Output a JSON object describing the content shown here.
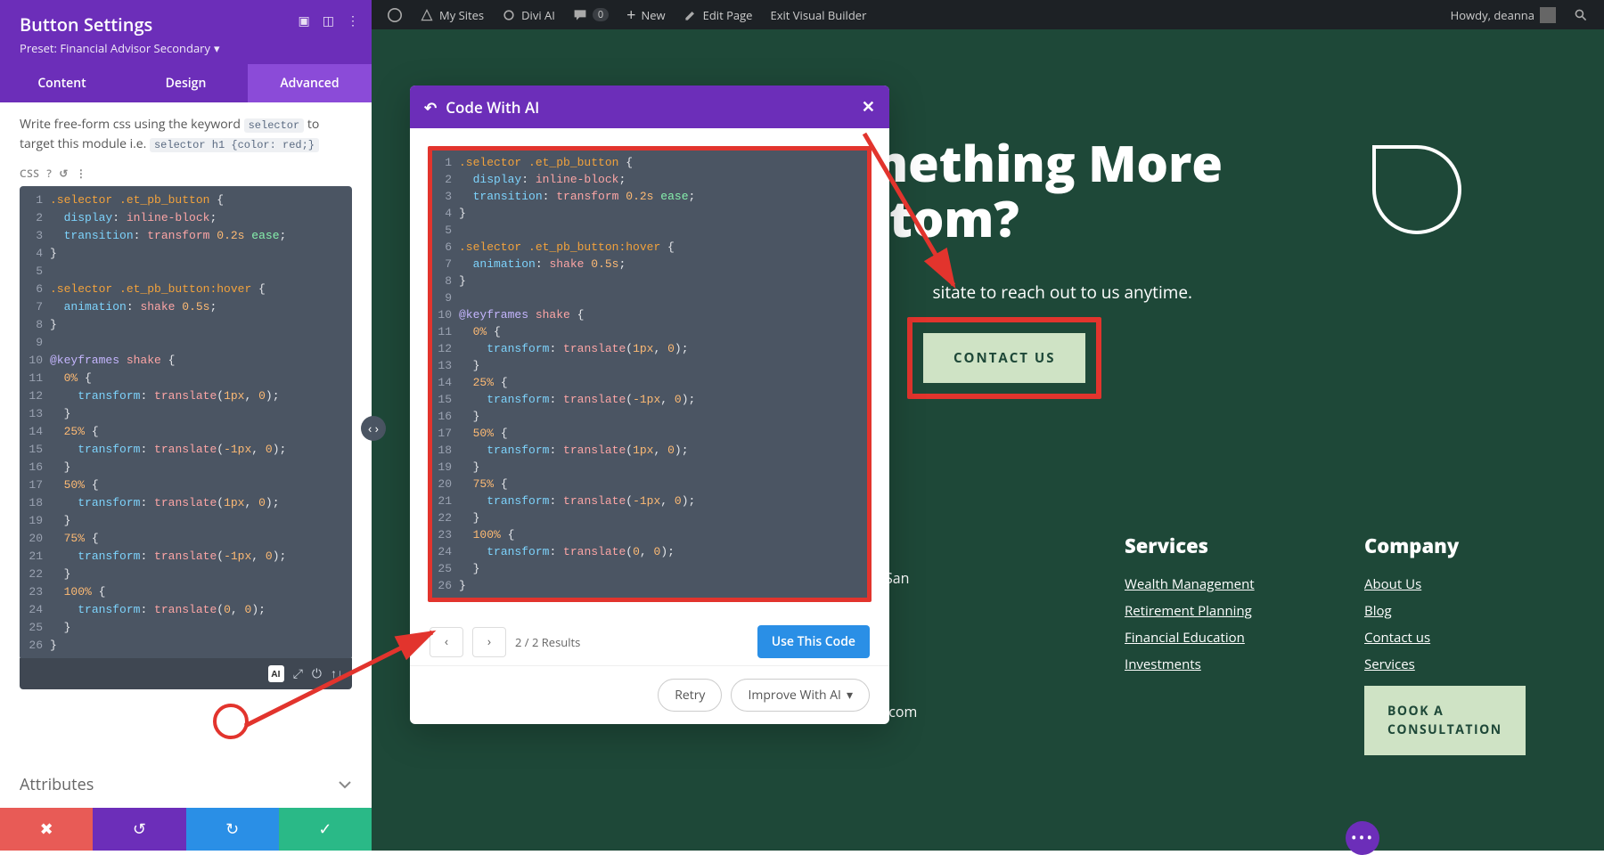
{
  "wp_bar": {
    "my_sites": "My Sites",
    "divi_ai": "Divi AI",
    "comments": "0",
    "new": "New",
    "edit_page": "Edit Page",
    "exit_builder": "Exit Visual Builder",
    "howdy": "Howdy, deanna"
  },
  "panel": {
    "title": "Button Settings",
    "preset": "Preset: Financial Advisor Secondary",
    "tabs": {
      "content": "Content",
      "design": "Design",
      "advanced": "Advanced"
    },
    "help_pre": "Write free-form css using the keyword ",
    "help_code1": "selector",
    "help_mid": " to target this module i.e. ",
    "help_code2": "selector h1 {color: red;}",
    "css_label": "CSS",
    "ai_badge": "AI",
    "attributes": "Attributes",
    "code": [
      {
        "n": "1",
        "s": ".selector .et_pb_button",
        "t": " {"
      },
      {
        "n": "2",
        "p": "display",
        "pv": ": ",
        "v": "inline-block",
        "pe": ";"
      },
      {
        "n": "3",
        "p": "transition",
        "pv": ": ",
        "vparts": [
          {
            "c": "tok-val",
            "t": "transform"
          },
          {
            "c": "",
            "t": " "
          },
          {
            "c": "tok-num",
            "t": "0.2s"
          },
          {
            "c": "",
            "t": " "
          },
          {
            "c": "tok-ease",
            "t": "ease"
          }
        ],
        "pe": ";"
      },
      {
        "n": "4",
        "t": "}"
      },
      {
        "n": "5",
        "t": ""
      },
      {
        "n": "6",
        "s": ".selector .et_pb_button",
        "shov": ":hover",
        "t": " {"
      },
      {
        "n": "7",
        "p": "animation",
        "pv": ": ",
        "vparts": [
          {
            "c": "tok-val",
            "t": "shake"
          },
          {
            "c": "",
            "t": " "
          },
          {
            "c": "tok-num",
            "t": "0.5s"
          }
        ],
        "pe": ";"
      },
      {
        "n": "8",
        "t": "}"
      },
      {
        "n": "9",
        "t": ""
      },
      {
        "n": "10",
        "kw": "@keyframes",
        "kwv": " shake",
        "t": " {"
      },
      {
        "n": "11",
        "pct": "0%",
        "t": " {"
      },
      {
        "n": "12",
        "p": "transform",
        "pv": ": ",
        "vparts": [
          {
            "c": "tok-val",
            "t": "translate"
          },
          {
            "c": "",
            "t": "("
          },
          {
            "c": "tok-num",
            "t": "1px"
          },
          {
            "c": "",
            "t": ", "
          },
          {
            "c": "tok-num",
            "t": "0"
          }
        ],
        "pe": ");"
      },
      {
        "n": "13",
        "t": "}"
      },
      {
        "n": "14",
        "pct": "25%",
        "t": " {"
      },
      {
        "n": "15",
        "p": "transform",
        "pv": ": ",
        "vparts": [
          {
            "c": "tok-val",
            "t": "translate"
          },
          {
            "c": "",
            "t": "("
          },
          {
            "c": "tok-num",
            "t": "-1px"
          },
          {
            "c": "",
            "t": ", "
          },
          {
            "c": "tok-num",
            "t": "0"
          }
        ],
        "pe": ");"
      },
      {
        "n": "16",
        "t": "}"
      },
      {
        "n": "17",
        "pct": "50%",
        "t": " {"
      },
      {
        "n": "18",
        "p": "transform",
        "pv": ": ",
        "vparts": [
          {
            "c": "tok-val",
            "t": "translate"
          },
          {
            "c": "",
            "t": "("
          },
          {
            "c": "tok-num",
            "t": "1px"
          },
          {
            "c": "",
            "t": ", "
          },
          {
            "c": "tok-num",
            "t": "0"
          }
        ],
        "pe": ");"
      },
      {
        "n": "19",
        "t": "}"
      },
      {
        "n": "20",
        "pct": "75%",
        "t": " {"
      },
      {
        "n": "21",
        "p": "transform",
        "pv": ": ",
        "vparts": [
          {
            "c": "tok-val",
            "t": "translate"
          },
          {
            "c": "",
            "t": "("
          },
          {
            "c": "tok-num",
            "t": "-1px"
          },
          {
            "c": "",
            "t": ", "
          },
          {
            "c": "tok-num",
            "t": "0"
          }
        ],
        "pe": ");"
      },
      {
        "n": "22",
        "t": "}"
      },
      {
        "n": "23",
        "pct": "100%",
        "t": " {"
      },
      {
        "n": "24",
        "p": "transform",
        "pv": ": ",
        "vparts": [
          {
            "c": "tok-val",
            "t": "translate"
          },
          {
            "c": "",
            "t": "("
          },
          {
            "c": "tok-num",
            "t": "0"
          },
          {
            "c": "",
            "t": ", "
          },
          {
            "c": "tok-num",
            "t": "0"
          }
        ],
        "pe": ");"
      },
      {
        "n": "25",
        "t": "}"
      },
      {
        "n": "26",
        "t": "}"
      }
    ]
  },
  "ai_popup": {
    "title": "Code With AI",
    "pager": "2 / 2 Results",
    "use_btn": "Use This Code",
    "retry": "Retry",
    "improve": "Improve With AI",
    "code": [
      {
        "n": "1",
        "s": ".selector .et_pb_button",
        "t": " {"
      },
      {
        "n": "2",
        "p": "display",
        "pv": ": ",
        "v": "inline-block",
        "pe": ";"
      },
      {
        "n": "3",
        "p": "transition",
        "pv": ": ",
        "vparts": [
          {
            "c": "tok-val",
            "t": "transform"
          },
          {
            "c": "",
            "t": " "
          },
          {
            "c": "tok-num",
            "t": "0.2s"
          },
          {
            "c": "",
            "t": " "
          },
          {
            "c": "tok-ease",
            "t": "ease"
          }
        ],
        "pe": ";"
      },
      {
        "n": "4",
        "t": "}"
      },
      {
        "n": "5",
        "t": ""
      },
      {
        "n": "6",
        "s": ".selector .et_pb_button",
        "shov": ":hover",
        "t": " {"
      },
      {
        "n": "7",
        "p": "animation",
        "pv": ": ",
        "vparts": [
          {
            "c": "tok-val",
            "t": "shake"
          },
          {
            "c": "",
            "t": " "
          },
          {
            "c": "tok-num",
            "t": "0.5s"
          }
        ],
        "pe": ";"
      },
      {
        "n": "8",
        "t": "}"
      },
      {
        "n": "9",
        "t": ""
      },
      {
        "n": "10",
        "kw": "@keyframes",
        "kwv": " shake",
        "t": " {"
      },
      {
        "n": "11",
        "pct": "0%",
        "t": " {"
      },
      {
        "n": "12",
        "p": "transform",
        "pv": ": ",
        "vparts": [
          {
            "c": "tok-val",
            "t": "translate"
          },
          {
            "c": "",
            "t": "("
          },
          {
            "c": "tok-num",
            "t": "1px"
          },
          {
            "c": "",
            "t": ", "
          },
          {
            "c": "tok-num",
            "t": "0"
          }
        ],
        "pe": ");"
      },
      {
        "n": "13",
        "t": "}"
      },
      {
        "n": "14",
        "pct": "25%",
        "t": " {"
      },
      {
        "n": "15",
        "p": "transform",
        "pv": ": ",
        "vparts": [
          {
            "c": "tok-val",
            "t": "translate"
          },
          {
            "c": "",
            "t": "("
          },
          {
            "c": "tok-num",
            "t": "-1px"
          },
          {
            "c": "",
            "t": ", "
          },
          {
            "c": "tok-num",
            "t": "0"
          }
        ],
        "pe": ");"
      },
      {
        "n": "16",
        "t": "}"
      },
      {
        "n": "17",
        "pct": "50%",
        "t": " {"
      },
      {
        "n": "18",
        "p": "transform",
        "pv": ": ",
        "vparts": [
          {
            "c": "tok-val",
            "t": "translate"
          },
          {
            "c": "",
            "t": "("
          },
          {
            "c": "tok-num",
            "t": "1px"
          },
          {
            "c": "",
            "t": ", "
          },
          {
            "c": "tok-num",
            "t": "0"
          }
        ],
        "pe": ");"
      },
      {
        "n": "19",
        "t": "}"
      },
      {
        "n": "20",
        "pct": "75%",
        "t": " {"
      },
      {
        "n": "21",
        "p": "transform",
        "pv": ": ",
        "vparts": [
          {
            "c": "tok-val",
            "t": "translate"
          },
          {
            "c": "",
            "t": "("
          },
          {
            "c": "tok-num",
            "t": "-1px"
          },
          {
            "c": "",
            "t": ", "
          },
          {
            "c": "tok-num",
            "t": "0"
          }
        ],
        "pe": ");"
      },
      {
        "n": "22",
        "t": "}"
      },
      {
        "n": "23",
        "pct": "100%",
        "t": " {"
      },
      {
        "n": "24",
        "p": "transform",
        "pv": ": ",
        "vparts": [
          {
            "c": "tok-val",
            "t": "translate"
          },
          {
            "c": "",
            "t": "("
          },
          {
            "c": "tok-num",
            "t": "0"
          },
          {
            "c": "",
            "t": ", "
          },
          {
            "c": "tok-num",
            "t": "0"
          }
        ],
        "pe": ");"
      },
      {
        "n": "25",
        "t": "}"
      },
      {
        "n": "26",
        "t": "}"
      }
    ]
  },
  "page": {
    "hero1": "Something More",
    "hero2": "Custom?",
    "hero_sub": "sitate to reach out to us anytime.",
    "contact_btn": "CONTACT US",
    "partial_san": "San",
    "partial_com": ".com",
    "services": {
      "title": "Services",
      "items": [
        "Wealth Management",
        "Retirement Planning",
        "Financial Education",
        "Investments"
      ]
    },
    "company": {
      "title": "Company",
      "items": [
        "About Us",
        "Blog",
        "Contact us",
        "Services"
      ]
    },
    "book_btn": "BOOK A CONSULTATION"
  }
}
